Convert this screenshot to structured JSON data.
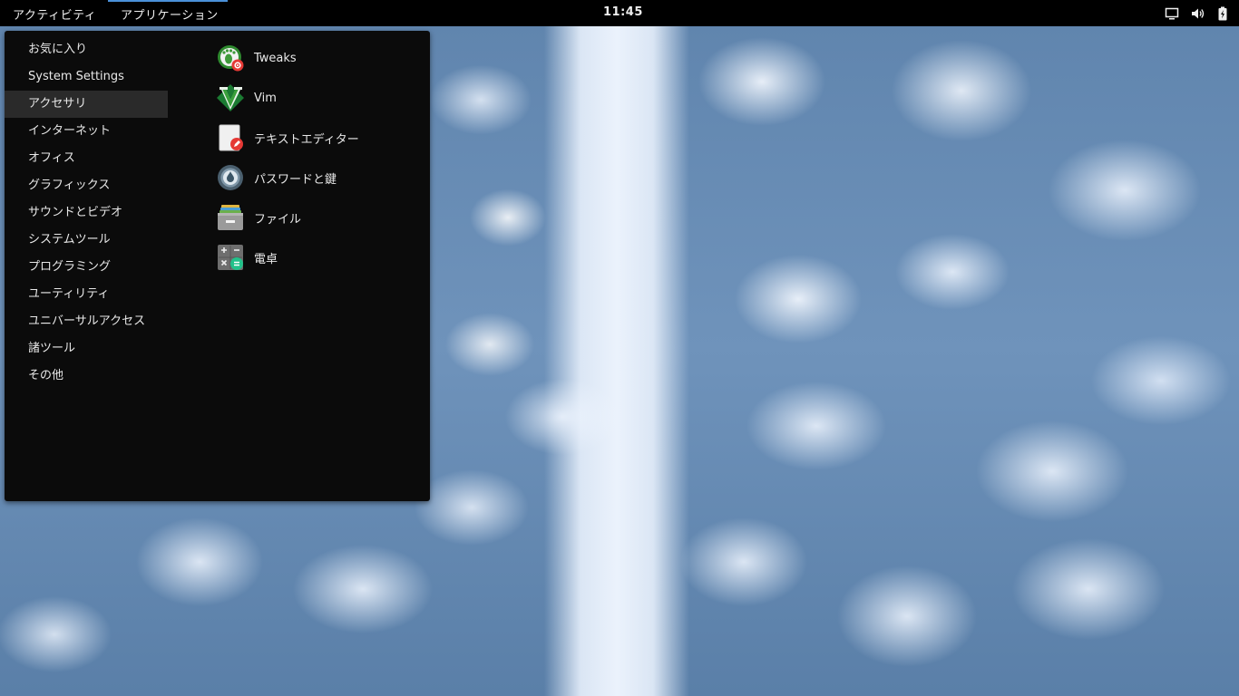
{
  "topbar": {
    "activities_label": "アクティビティ",
    "applications_label": "アプリケーション",
    "clock": "11:45",
    "tray_icons": [
      "display-icon",
      "volume-icon",
      "battery-icon"
    ]
  },
  "menu": {
    "categories": [
      {
        "label": "お気に入り"
      },
      {
        "label": "System Settings"
      },
      {
        "label": "アクセサリ",
        "selected": true
      },
      {
        "label": "インターネット"
      },
      {
        "label": "オフィス"
      },
      {
        "label": "グラフィックス"
      },
      {
        "label": "サウンドとビデオ"
      },
      {
        "label": "システムツール"
      },
      {
        "label": "プログラミング"
      },
      {
        "label": "ユーティリティ"
      },
      {
        "label": "ユニバーサルアクセス"
      },
      {
        "label": "諸ツール"
      },
      {
        "label": "その他"
      }
    ],
    "apps": [
      {
        "label": "Tweaks",
        "icon": "tweaks-icon"
      },
      {
        "label": "Vim",
        "icon": "vim-icon"
      },
      {
        "label": "テキストエディター",
        "icon": "text-editor-icon"
      },
      {
        "label": "パスワードと鍵",
        "icon": "passwords-keys-icon"
      },
      {
        "label": "ファイル",
        "icon": "files-icon"
      },
      {
        "label": "電卓",
        "icon": "calculator-icon"
      }
    ]
  },
  "colors": {
    "topbar_bg": "#000000",
    "menu_bg": "#0b0b0b",
    "selected_bg": "#2a2a2a",
    "accent": "#4a90d9"
  }
}
